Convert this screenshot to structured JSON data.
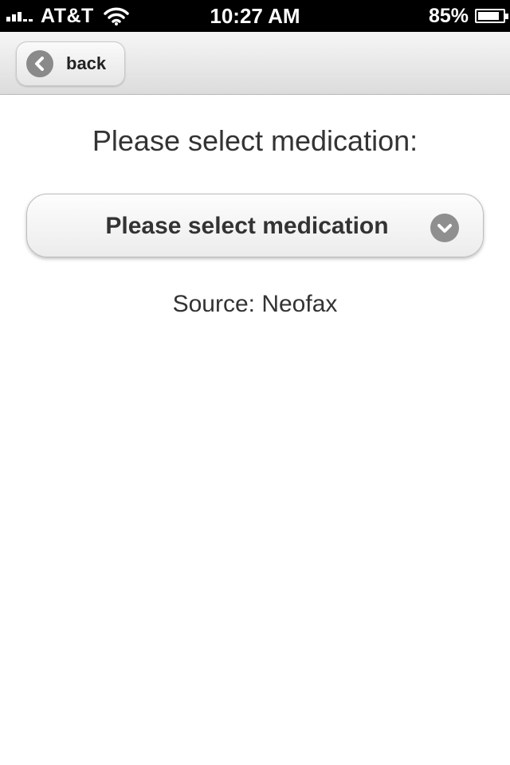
{
  "status_bar": {
    "carrier": "AT&T",
    "time": "10:27 AM",
    "battery_percent": "85%",
    "battery_level": 0.85,
    "signal_bars": 3,
    "signal_icon": "cellular-signal-icon",
    "wifi_icon": "wifi-icon",
    "battery_icon": "battery-icon"
  },
  "header": {
    "back_label": "back",
    "back_icon": "chevron-left-icon"
  },
  "main": {
    "prompt": "Please select medication:",
    "select": {
      "selected_value": "Please select medication",
      "icon": "chevron-down-icon"
    },
    "source": "Source: Neofax"
  },
  "colors": {
    "status_bar_bg": "#000000",
    "header_bg": "#e6e6e6",
    "icon_gray": "#8a8a8a",
    "text": "#333333"
  }
}
